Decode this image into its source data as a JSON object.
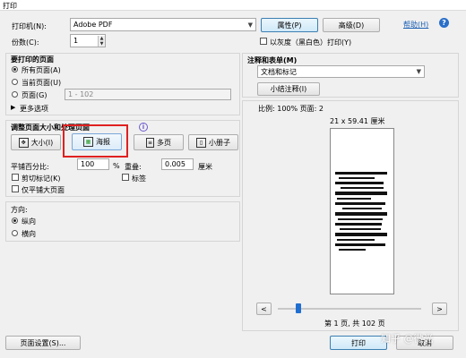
{
  "window": {
    "title": "打印"
  },
  "printer": {
    "label": "打印机(N):",
    "value": "Adobe PDF",
    "properties_button": "属性(P)",
    "advanced_button": "高级(D)",
    "help_link": "帮助(H)",
    "help_icon": "question-circle-icon"
  },
  "copies": {
    "label": "份数(C):",
    "value": "1"
  },
  "grayscale": {
    "label": "以灰度（黑白色）打印(Y)",
    "checked": false
  },
  "pages_group": {
    "title": "要打印的页面",
    "all_pages": "所有页面(A)",
    "current_page": "当前页面(U)",
    "pages": "页面(G)",
    "pages_range_placeholder": "1 - 102",
    "more_options": "更多选项",
    "selected": "all"
  },
  "sizing_group": {
    "title": "调整页面大小和处理页面",
    "info_icon": "info-icon",
    "buttons": [
      "大小(I)",
      "海报",
      "多页",
      "小册子"
    ],
    "active_button": "海报",
    "tile_scale_label": "平铺百分比:",
    "tile_scale_value": "100",
    "tile_scale_unit": "%",
    "overlap_label": "重叠:",
    "overlap_value": "0.005",
    "overlap_unit": "厘米",
    "cut_marks": "剪切标记(K)",
    "labels": "标签",
    "tile_large_pages": "仅平铺大页面"
  },
  "orientation_group": {
    "title": "方向:",
    "portrait": "纵向",
    "landscape": "横向",
    "selected": "portrait"
  },
  "comments_group": {
    "title": "注释和表单(M)",
    "value": "文档和标记",
    "summarize_button": "小结注释(I)"
  },
  "preview": {
    "scale_text": "比例: 100% 页面: 2",
    "dimensions": "21 x 59.41 厘米",
    "prev_button": "<",
    "next_button": ">",
    "page_status": "第 1 页, 共 102 页",
    "slider_level": 0.0
  },
  "footer": {
    "page_setup_button": "页面设置(S)...",
    "print_button": "打印",
    "cancel_button": "取消"
  },
  "watermark": "知乎 @微光"
}
